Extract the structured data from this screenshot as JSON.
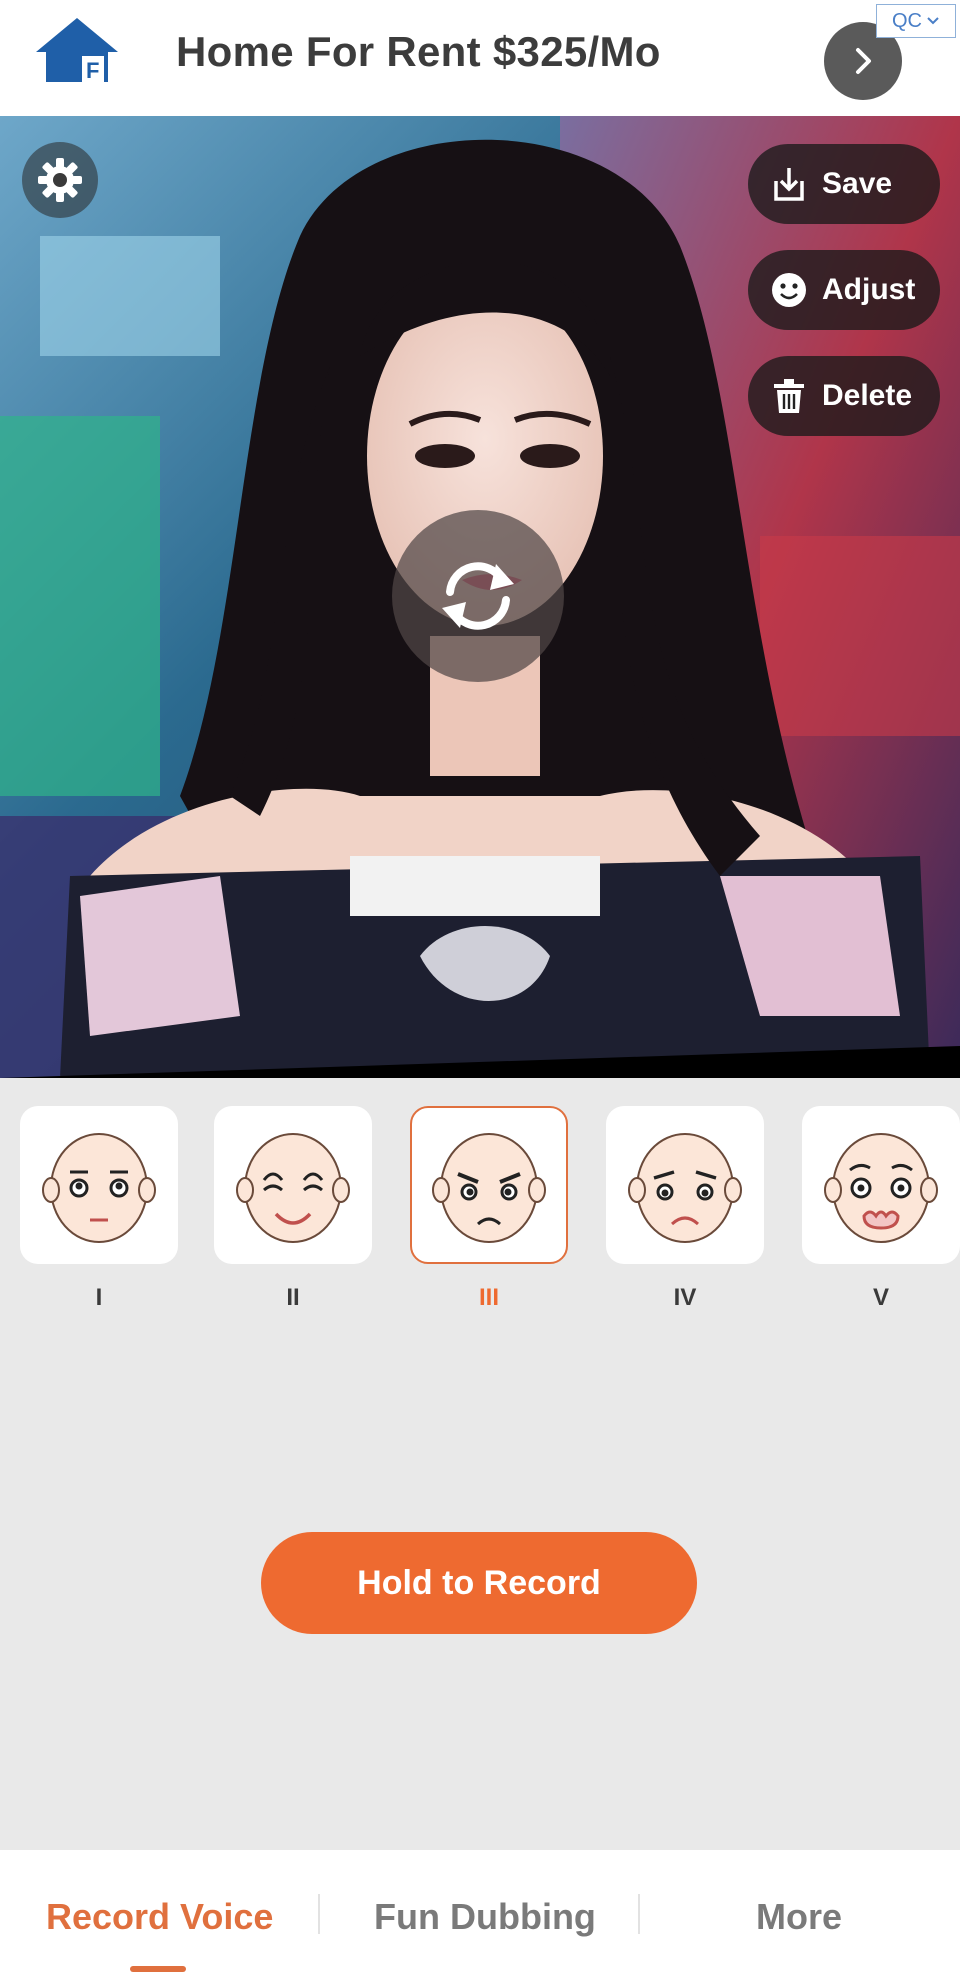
{
  "ad": {
    "title": "Home For Rent $325/Mo",
    "badge": "QC",
    "logo_icon": "house-logo-icon",
    "next_icon": "chevron-right-icon"
  },
  "photo_tools": {
    "settings_icon": "gear-icon",
    "save_label": "Save",
    "adjust_label": "Adjust",
    "delete_label": "Delete",
    "rotate_icon": "refresh-icon"
  },
  "faces": [
    {
      "label": "I",
      "expression": "neutral",
      "selected": false
    },
    {
      "label": "II",
      "expression": "happy",
      "selected": false
    },
    {
      "label": "III",
      "expression": "angry",
      "selected": true
    },
    {
      "label": "IV",
      "expression": "sad",
      "selected": false
    },
    {
      "label": "V",
      "expression": "shocked",
      "selected": false
    }
  ],
  "record_button": "Hold to Record",
  "tabs": [
    {
      "label": "Record Voice",
      "active": true
    },
    {
      "label": "Fun Dubbing",
      "active": false
    },
    {
      "label": "More",
      "active": false
    }
  ],
  "colors": {
    "accent": "#ee6a30",
    "tab_active": "#e0703e",
    "background": "#e9e9e9"
  }
}
